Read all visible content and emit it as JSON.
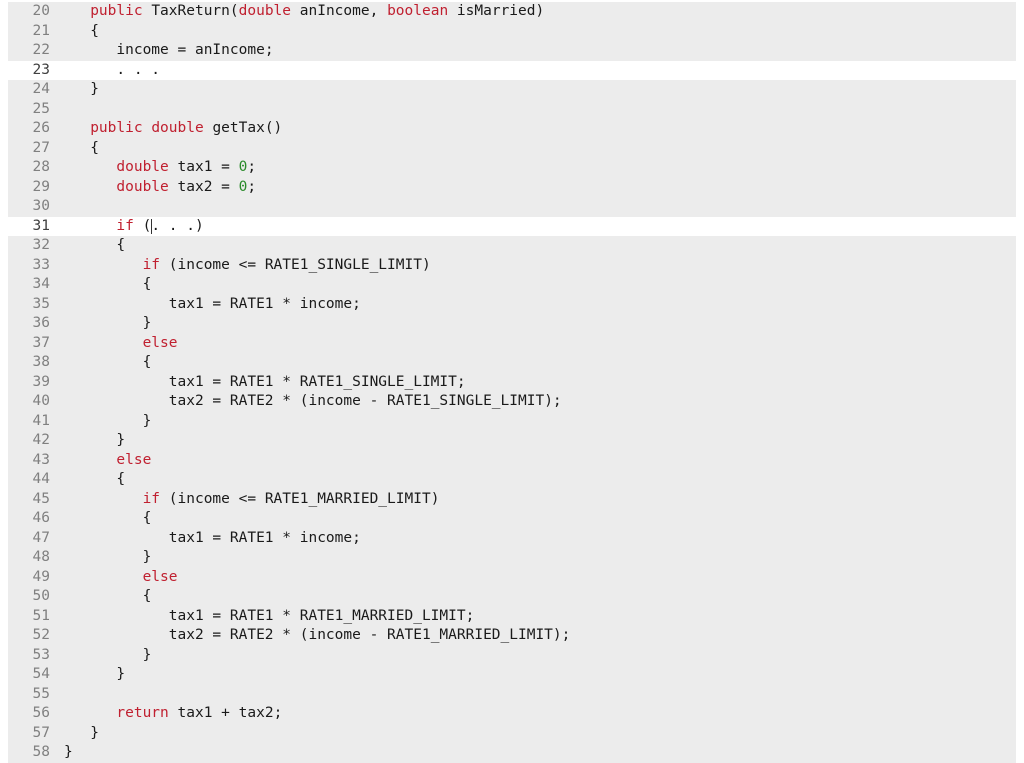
{
  "code": {
    "first_line_number": 20,
    "highlighted_lines": [
      23,
      31
    ],
    "cursor": {
      "line": 31,
      "after_token_index": 3
    },
    "lines": [
      {
        "n": 20,
        "ind": 3,
        "t": [
          {
            "c": "tok-keyword",
            "s": "public"
          },
          {
            "c": "tok-ident",
            "s": " TaxReturn"
          },
          {
            "c": "tok-punct",
            "s": "("
          },
          {
            "c": "tok-type",
            "s": "double"
          },
          {
            "c": "tok-ident",
            "s": " anIncome"
          },
          {
            "c": "tok-punct",
            "s": ", "
          },
          {
            "c": "tok-type",
            "s": "boolean"
          },
          {
            "c": "tok-ident",
            "s": " isMarried"
          },
          {
            "c": "tok-punct",
            "s": ")"
          }
        ]
      },
      {
        "n": 21,
        "ind": 3,
        "t": [
          {
            "c": "tok-punct",
            "s": "{"
          }
        ]
      },
      {
        "n": 22,
        "ind": 6,
        "t": [
          {
            "c": "tok-ident",
            "s": "income "
          },
          {
            "c": "tok-operator",
            "s": "="
          },
          {
            "c": "tok-ident",
            "s": " anIncome"
          },
          {
            "c": "tok-punct",
            "s": ";"
          }
        ]
      },
      {
        "n": 23,
        "ind": 6,
        "t": [
          {
            "c": "tok-punct",
            "s": ". . ."
          }
        ]
      },
      {
        "n": 24,
        "ind": 3,
        "t": [
          {
            "c": "tok-punct",
            "s": "}"
          }
        ]
      },
      {
        "n": 25,
        "ind": 0,
        "t": []
      },
      {
        "n": 26,
        "ind": 3,
        "t": [
          {
            "c": "tok-keyword",
            "s": "public"
          },
          {
            "c": "tok-ident",
            "s": " "
          },
          {
            "c": "tok-type",
            "s": "double"
          },
          {
            "c": "tok-ident",
            "s": " getTax"
          },
          {
            "c": "tok-punct",
            "s": "()"
          }
        ]
      },
      {
        "n": 27,
        "ind": 3,
        "t": [
          {
            "c": "tok-punct",
            "s": "{"
          }
        ]
      },
      {
        "n": 28,
        "ind": 6,
        "t": [
          {
            "c": "tok-type",
            "s": "double"
          },
          {
            "c": "tok-ident",
            "s": " tax1 "
          },
          {
            "c": "tok-operator",
            "s": "="
          },
          {
            "c": "tok-ident",
            "s": " "
          },
          {
            "c": "tok-number",
            "s": "0"
          },
          {
            "c": "tok-punct",
            "s": ";"
          }
        ]
      },
      {
        "n": 29,
        "ind": 6,
        "t": [
          {
            "c": "tok-type",
            "s": "double"
          },
          {
            "c": "tok-ident",
            "s": " tax2 "
          },
          {
            "c": "tok-operator",
            "s": "="
          },
          {
            "c": "tok-ident",
            "s": " "
          },
          {
            "c": "tok-number",
            "s": "0"
          },
          {
            "c": "tok-punct",
            "s": ";"
          }
        ]
      },
      {
        "n": 30,
        "ind": 0,
        "t": []
      },
      {
        "n": 31,
        "ind": 6,
        "t": [
          {
            "c": "tok-keyword",
            "s": "if"
          },
          {
            "c": "tok-ident",
            "s": " "
          },
          {
            "c": "tok-punct",
            "s": "("
          },
          {
            "c": "tok-punct",
            "s": ". . ."
          },
          {
            "c": "tok-punct",
            "s": ")"
          }
        ]
      },
      {
        "n": 32,
        "ind": 6,
        "t": [
          {
            "c": "tok-punct",
            "s": "{"
          }
        ]
      },
      {
        "n": 33,
        "ind": 9,
        "t": [
          {
            "c": "tok-keyword",
            "s": "if"
          },
          {
            "c": "tok-ident",
            "s": " "
          },
          {
            "c": "tok-punct",
            "s": "("
          },
          {
            "c": "tok-ident",
            "s": "income "
          },
          {
            "c": "tok-operator",
            "s": "<="
          },
          {
            "c": "tok-ident",
            "s": " RATE1_SINGLE_LIMIT"
          },
          {
            "c": "tok-punct",
            "s": ")"
          }
        ]
      },
      {
        "n": 34,
        "ind": 9,
        "t": [
          {
            "c": "tok-punct",
            "s": "{"
          }
        ]
      },
      {
        "n": 35,
        "ind": 12,
        "t": [
          {
            "c": "tok-ident",
            "s": "tax1 "
          },
          {
            "c": "tok-operator",
            "s": "="
          },
          {
            "c": "tok-ident",
            "s": " RATE1 "
          },
          {
            "c": "tok-operator",
            "s": "*"
          },
          {
            "c": "tok-ident",
            "s": " income"
          },
          {
            "c": "tok-punct",
            "s": ";"
          }
        ]
      },
      {
        "n": 36,
        "ind": 9,
        "t": [
          {
            "c": "tok-punct",
            "s": "}"
          }
        ]
      },
      {
        "n": 37,
        "ind": 9,
        "t": [
          {
            "c": "tok-keyword",
            "s": "else"
          }
        ]
      },
      {
        "n": 38,
        "ind": 9,
        "t": [
          {
            "c": "tok-punct",
            "s": "{"
          }
        ]
      },
      {
        "n": 39,
        "ind": 12,
        "t": [
          {
            "c": "tok-ident",
            "s": "tax1 "
          },
          {
            "c": "tok-operator",
            "s": "="
          },
          {
            "c": "tok-ident",
            "s": " RATE1 "
          },
          {
            "c": "tok-operator",
            "s": "*"
          },
          {
            "c": "tok-ident",
            "s": " RATE1_SINGLE_LIMIT"
          },
          {
            "c": "tok-punct",
            "s": ";"
          }
        ]
      },
      {
        "n": 40,
        "ind": 12,
        "t": [
          {
            "c": "tok-ident",
            "s": "tax2 "
          },
          {
            "c": "tok-operator",
            "s": "="
          },
          {
            "c": "tok-ident",
            "s": " RATE2 "
          },
          {
            "c": "tok-operator",
            "s": "*"
          },
          {
            "c": "tok-ident",
            "s": " "
          },
          {
            "c": "tok-punct",
            "s": "("
          },
          {
            "c": "tok-ident",
            "s": "income "
          },
          {
            "c": "tok-operator",
            "s": "-"
          },
          {
            "c": "tok-ident",
            "s": " RATE1_SINGLE_LIMIT"
          },
          {
            "c": "tok-punct",
            "s": ")"
          },
          {
            "c": "tok-punct",
            "s": ";"
          }
        ]
      },
      {
        "n": 41,
        "ind": 9,
        "t": [
          {
            "c": "tok-punct",
            "s": "}"
          }
        ]
      },
      {
        "n": 42,
        "ind": 6,
        "t": [
          {
            "c": "tok-punct",
            "s": "}"
          }
        ]
      },
      {
        "n": 43,
        "ind": 6,
        "t": [
          {
            "c": "tok-keyword",
            "s": "else"
          }
        ]
      },
      {
        "n": 44,
        "ind": 6,
        "t": [
          {
            "c": "tok-punct",
            "s": "{"
          }
        ]
      },
      {
        "n": 45,
        "ind": 9,
        "t": [
          {
            "c": "tok-keyword",
            "s": "if"
          },
          {
            "c": "tok-ident",
            "s": " "
          },
          {
            "c": "tok-punct",
            "s": "("
          },
          {
            "c": "tok-ident",
            "s": "income "
          },
          {
            "c": "tok-operator",
            "s": "<="
          },
          {
            "c": "tok-ident",
            "s": " RATE1_MARRIED_LIMIT"
          },
          {
            "c": "tok-punct",
            "s": ")"
          }
        ]
      },
      {
        "n": 46,
        "ind": 9,
        "t": [
          {
            "c": "tok-punct",
            "s": "{"
          }
        ]
      },
      {
        "n": 47,
        "ind": 12,
        "t": [
          {
            "c": "tok-ident",
            "s": "tax1 "
          },
          {
            "c": "tok-operator",
            "s": "="
          },
          {
            "c": "tok-ident",
            "s": " RATE1 "
          },
          {
            "c": "tok-operator",
            "s": "*"
          },
          {
            "c": "tok-ident",
            "s": " income"
          },
          {
            "c": "tok-punct",
            "s": ";"
          }
        ]
      },
      {
        "n": 48,
        "ind": 9,
        "t": [
          {
            "c": "tok-punct",
            "s": "}"
          }
        ]
      },
      {
        "n": 49,
        "ind": 9,
        "t": [
          {
            "c": "tok-keyword",
            "s": "else"
          }
        ]
      },
      {
        "n": 50,
        "ind": 9,
        "t": [
          {
            "c": "tok-punct",
            "s": "{"
          }
        ]
      },
      {
        "n": 51,
        "ind": 12,
        "t": [
          {
            "c": "tok-ident",
            "s": "tax1 "
          },
          {
            "c": "tok-operator",
            "s": "="
          },
          {
            "c": "tok-ident",
            "s": " RATE1 "
          },
          {
            "c": "tok-operator",
            "s": "*"
          },
          {
            "c": "tok-ident",
            "s": " RATE1_MARRIED_LIMIT"
          },
          {
            "c": "tok-punct",
            "s": ";"
          }
        ]
      },
      {
        "n": 52,
        "ind": 12,
        "t": [
          {
            "c": "tok-ident",
            "s": "tax2 "
          },
          {
            "c": "tok-operator",
            "s": "="
          },
          {
            "c": "tok-ident",
            "s": " RATE2 "
          },
          {
            "c": "tok-operator",
            "s": "*"
          },
          {
            "c": "tok-ident",
            "s": " "
          },
          {
            "c": "tok-punct",
            "s": "("
          },
          {
            "c": "tok-ident",
            "s": "income "
          },
          {
            "c": "tok-operator",
            "s": "-"
          },
          {
            "c": "tok-ident",
            "s": " RATE1_MARRIED_LIMIT"
          },
          {
            "c": "tok-punct",
            "s": ")"
          },
          {
            "c": "tok-punct",
            "s": ";"
          }
        ]
      },
      {
        "n": 53,
        "ind": 9,
        "t": [
          {
            "c": "tok-punct",
            "s": "}"
          }
        ]
      },
      {
        "n": 54,
        "ind": 6,
        "t": [
          {
            "c": "tok-punct",
            "s": "}"
          }
        ]
      },
      {
        "n": 55,
        "ind": 0,
        "t": []
      },
      {
        "n": 56,
        "ind": 6,
        "t": [
          {
            "c": "tok-keyword",
            "s": "return"
          },
          {
            "c": "tok-ident",
            "s": " tax1 "
          },
          {
            "c": "tok-operator",
            "s": "+"
          },
          {
            "c": "tok-ident",
            "s": " tax2"
          },
          {
            "c": "tok-punct",
            "s": ";"
          }
        ]
      },
      {
        "n": 57,
        "ind": 3,
        "t": [
          {
            "c": "tok-punct",
            "s": "}"
          }
        ]
      },
      {
        "n": 58,
        "ind": 0,
        "t": [
          {
            "c": "tok-punct",
            "s": "}"
          }
        ]
      }
    ]
  }
}
